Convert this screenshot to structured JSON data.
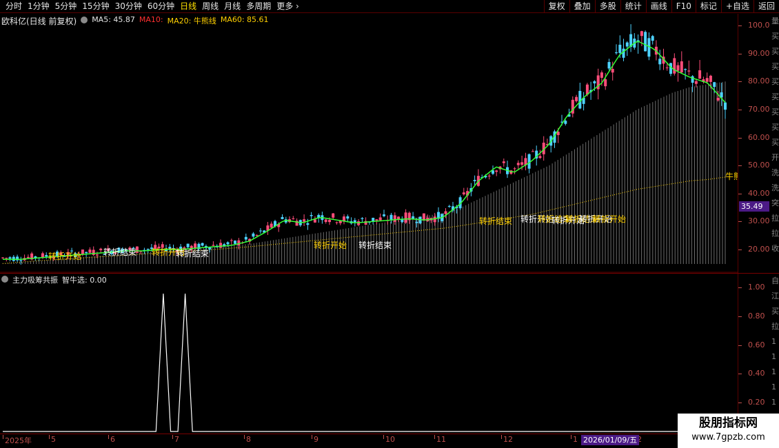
{
  "toolbar": {
    "periods": [
      "分时",
      "1分钟",
      "5分钟",
      "15分钟",
      "30分钟",
      "60分钟",
      "日线",
      "周线",
      "月线",
      "多周期"
    ],
    "active_period": "日线",
    "more_label": "更多",
    "more_icon": "chevron-right-icon",
    "buttons": [
      "复权",
      "叠加",
      "多股",
      "统计",
      "画线",
      "F10",
      "标记",
      "+自选",
      "返回"
    ]
  },
  "main_header": {
    "title": "欧科亿(日线 前复权)",
    "ma5": "MA5: 45.87",
    "ma10": "MA10:",
    "ma20": "MA20: 牛熊线",
    "ma60": "MA60: 85.61"
  },
  "sub_header": {
    "title": "主力吸筹共振",
    "value": "智牛选: 0.00"
  },
  "price_axis": {
    "ticks": [
      "100.0",
      "90.00",
      "80.00",
      "70.00",
      "60.00",
      "50.00",
      "40.00",
      "30.00",
      "20.00"
    ],
    "current_price": "35.49",
    "right_labels": [
      "量",
      "买",
      "买",
      "买",
      "买",
      "买",
      "买",
      "买",
      "买",
      "开",
      "洗",
      "洗",
      "突",
      "拉",
      "拉",
      "收"
    ]
  },
  "sub_axis": {
    "ticks": [
      "1.00",
      "0.80",
      "0.60",
      "0.40",
      "0.20"
    ],
    "right_labels": [
      "自",
      "江",
      "买",
      "拉",
      "1",
      "1",
      "1",
      "1",
      "1"
    ]
  },
  "date_axis": {
    "labels": [
      "2025年",
      "5",
      "6",
      "7",
      "8",
      "9",
      "10",
      "11",
      "12",
      "1",
      "2"
    ],
    "cursor_date": "2026/01/09/五"
  },
  "chart_annotations": {
    "signals": [
      "转折开始",
      "转折结束",
      "转折开始",
      "转折结束",
      "转折开始",
      "转折结束",
      "转折结束",
      "转折开始",
      "转折结束",
      "转折开始",
      "转折结束",
      "转折开始",
      "转折开始"
    ],
    "right_edge_label": "牛熊"
  },
  "watermark": {
    "title": "股朋指标网",
    "url": "www.7gpzb.com"
  },
  "colors": {
    "up_candle": "#ff4d7a",
    "down_candle": "#4dd2ff",
    "ma5": "#e6e6e6",
    "ma10": "#ff3030",
    "ma20": "#ffd000",
    "ma60": "#ffd000",
    "green_line": "#33ff33",
    "highlight": "#4b1a86"
  },
  "chart_data": [
    {
      "type": "line",
      "title": "欧科亿(日线 前复权)",
      "x_labels": [
        "2025年",
        "5",
        "6",
        "7",
        "8",
        "9",
        "10",
        "11",
        "12",
        "1",
        "2"
      ],
      "ylim": [
        15,
        100
      ],
      "series": [
        {
          "name": "price",
          "values": [
            17,
            17,
            17.5,
            18,
            18.5,
            19,
            19.5,
            20,
            20,
            20.5,
            20.5,
            21,
            21.5,
            22,
            23.5,
            27,
            31,
            30,
            32,
            31,
            30,
            30.5,
            31,
            31.5,
            31,
            32,
            37,
            45,
            50,
            48,
            52,
            58,
            68,
            75,
            80,
            90,
            95,
            92,
            85,
            82,
            80,
            73
          ]
        },
        {
          "name": "MA60",
          "values": [
            15,
            15.5,
            16,
            16.5,
            17,
            17.5,
            18,
            18.5,
            19,
            19.5,
            20,
            20.5,
            21,
            21.5,
            22,
            23,
            24,
            25,
            26,
            27,
            28,
            29,
            30,
            31,
            32,
            33,
            35,
            38,
            41,
            44,
            47,
            50,
            54,
            58,
            62,
            66,
            70,
            73,
            76,
            78,
            79,
            80
          ]
        },
        {
          "name": "MA20",
          "values": [
            15,
            15.5,
            16,
            16.4,
            16.8,
            17.2,
            17.6,
            18,
            18.4,
            18.8,
            19.2,
            19.6,
            20,
            20.5,
            21,
            21.6,
            22.2,
            22.8,
            23.4,
            24,
            24.6,
            25.2,
            25.8,
            26.4,
            27,
            27.6,
            28.5,
            29.5,
            30.5,
            31.5,
            32.5,
            34,
            35.5,
            37,
            38.5,
            40,
            41.5,
            42.5,
            43.5,
            44.5,
            45,
            45.87
          ]
        }
      ]
    },
    {
      "type": "line",
      "title": "主力吸筹共振",
      "ylim": [
        0,
        1.05
      ],
      "series": [
        {
          "name": "智牛选",
          "values": [
            0,
            0,
            0,
            0,
            0,
            0,
            0,
            0,
            0,
            0,
            0,
            0,
            0,
            0,
            0,
            0,
            0,
            0,
            0,
            0,
            0,
            0,
            1,
            0,
            0,
            1,
            0,
            0,
            0,
            0,
            0,
            0,
            0,
            0,
            0,
            0,
            0,
            0,
            0,
            0,
            0,
            0,
            0,
            0,
            0,
            0,
            0,
            0,
            0,
            0,
            0,
            0,
            0,
            0,
            0,
            0,
            0,
            0,
            0,
            0,
            0,
            0,
            0,
            0,
            0,
            0,
            0,
            0,
            0,
            0,
            0,
            0,
            0,
            0,
            0,
            0,
            0,
            0,
            0,
            0,
            0,
            0,
            0,
            0,
            0,
            0,
            0,
            0,
            0,
            0,
            0,
            0,
            0,
            0,
            0,
            0,
            0,
            0,
            0,
            0
          ]
        }
      ]
    }
  ]
}
